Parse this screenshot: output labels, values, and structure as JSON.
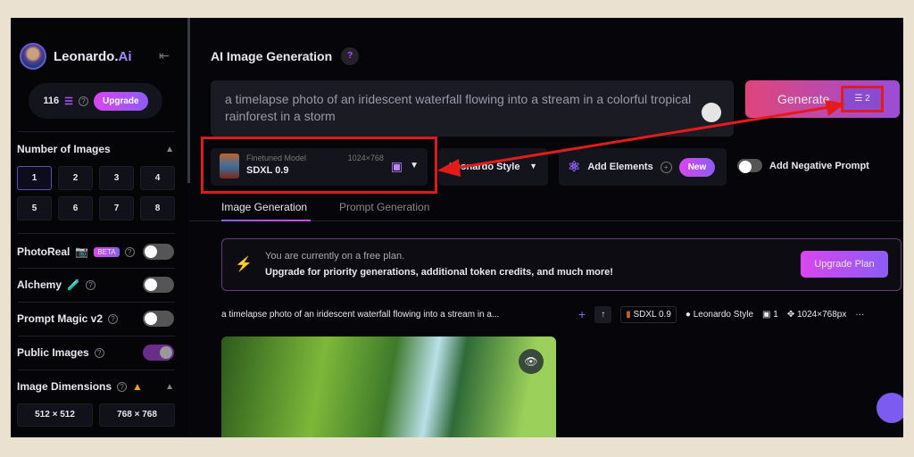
{
  "sidebar": {
    "brand": "Leonardo.",
    "brand_ai": "Ai",
    "credits": "116",
    "upgrade": "Upgrade",
    "num_images_label": "Number of Images",
    "num_options": [
      "1",
      "2",
      "3",
      "4",
      "5",
      "6",
      "7",
      "8"
    ],
    "num_selected": "1",
    "toggles": [
      {
        "label": "PhotoReal",
        "badge": "BETA",
        "on": false
      },
      {
        "label": "Alchemy",
        "on": false
      },
      {
        "label": "Prompt Magic v2",
        "on": false
      },
      {
        "label": "Public Images",
        "on": true
      }
    ],
    "dims_label": "Image Dimensions",
    "dims": [
      "512 × 512",
      "768 × 768"
    ]
  },
  "main": {
    "title": "AI Image Generation",
    "prompt": "a timelapse photo of an iridescent waterfall flowing into a stream in a colorful tropical rainforest in a storm",
    "generate": "Generate",
    "generate_count": "2",
    "model_type": "Finetuned Model",
    "model_name": "SDXL 0.9",
    "model_res": "1024×768",
    "style": "Leonardo Style",
    "add_elements": "Add Elements",
    "new_badge": "New",
    "negative_prompt": "Add Negative Prompt",
    "tabs": [
      "Image Generation",
      "Prompt Generation"
    ],
    "banner": {
      "line1": "You are currently on a free plan.",
      "line2": "Upgrade for priority generations, additional token credits, and much more!",
      "button": "Upgrade Plan"
    },
    "meta": {
      "prompt": "a timelapse photo of an iridescent waterfall flowing into a stream in a...",
      "model": "SDXL 0.9",
      "style": "Leonardo Style",
      "count": "1",
      "res": "1024×768px"
    }
  },
  "colors": {
    "accent": "#8b5cf6",
    "highlight": "#e31b1b"
  }
}
